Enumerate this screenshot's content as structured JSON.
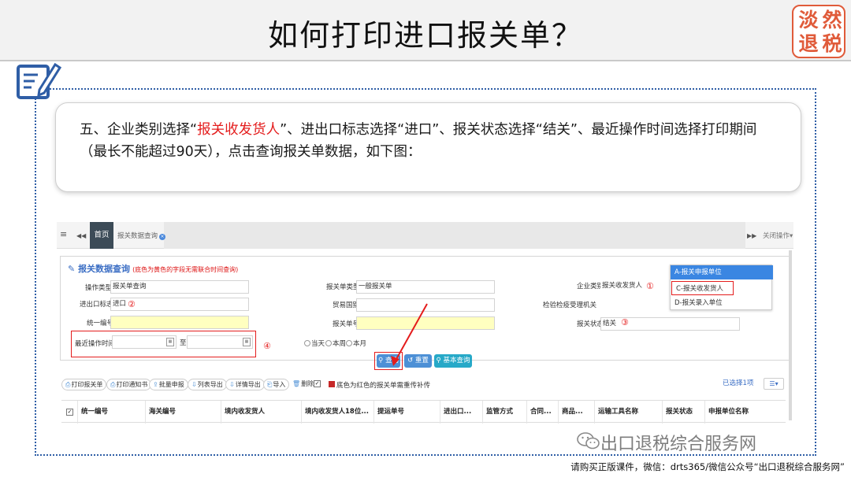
{
  "slide": {
    "title": "如何打印进口报关单？",
    "logo_chars": [
      "淡",
      "然",
      "退",
      "税"
    ],
    "instruction": {
      "prefix": "五、企业类别选择“",
      "highlight": "报关收发货人",
      "suffix": "”、进出口标志选择“进口”、报关状态选择“结关”、最近操作时间选择打印期间（最长不能超过90天），点击查询报关单数据，如下图："
    },
    "watermark": "出口退税综合服务网",
    "footer": "请购买正版课件，微信：drts365/微信公众号“出口退税综合服务网”",
    "colors": {
      "accent_red": "#e41c1c",
      "frame_blue": "#2f5ea6",
      "logo_red": "#e05b3a"
    }
  },
  "app": {
    "nav": {
      "menu_icon": "≡",
      "prev_icon": "◀◀",
      "next_icon": "▶▶",
      "home_tab": "首页",
      "query_tab": "报关数据查询",
      "close_ops": "关闭操作▾"
    },
    "form": {
      "title": "报关数据查询",
      "title_hint": "(底色为黄色的字段无需联合时间查询)",
      "fields": {
        "op_type_label": "操作类型",
        "op_type_value": "报关单查询",
        "ie_flag_label": "进出口标志",
        "ie_flag_value": "进口",
        "unified_no_label": "统一编号",
        "recent_time_label": "最近操作时间",
        "to_label": "至",
        "decl_type_label": "报关单类型",
        "decl_type_value": "一般报关单",
        "trade_country_label": "贸易国别",
        "decl_no_label": "报关单号",
        "company_type_label": "企业类别",
        "company_type_value": "报关收发货人",
        "inspect_org_label": "检验检疫受理机关",
        "decl_status_label": "报关状态",
        "decl_status_value": "结关"
      },
      "markers": [
        "①",
        "②",
        "③",
        "④"
      ],
      "radios": [
        "当天",
        "本周",
        "本月"
      ],
      "buttons": {
        "search": "查询",
        "reset": "重置",
        "basic": "基本查询"
      },
      "dropdown": [
        "A-报关申报单位",
        "C-报关收发货人",
        "D-报关录入单位"
      ]
    },
    "toolbar": {
      "buttons": [
        "打印报关单",
        "打印通知书",
        "批量申报",
        "列表导出",
        "详情导出",
        "导入",
        "删除"
      ],
      "red_note": "底色为红色的报关单需重传补传",
      "selected": "已选择1项",
      "view_icon": "☰▾"
    },
    "grid_columns": [
      "统一编号",
      "海关编号",
      "境内收发货人",
      "境内收发货人18位...",
      "提运单号",
      "进出口...",
      "监管方式",
      "合同...",
      "商品...",
      "运输工具名称",
      "报关状态",
      "申报单位名称"
    ]
  }
}
